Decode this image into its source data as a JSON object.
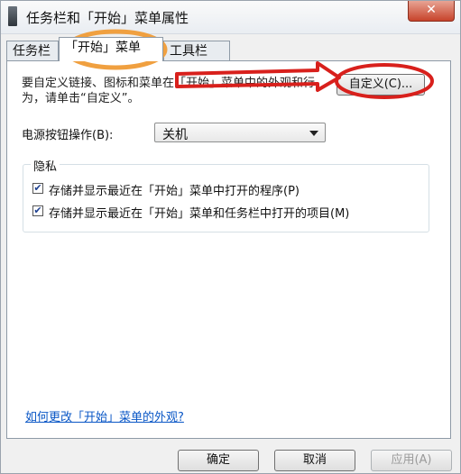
{
  "window": {
    "title": "任务栏和「开始」菜单属性",
    "close_glyph": "✕"
  },
  "tabs": [
    {
      "label": "任务栏"
    },
    {
      "label": "「开始」菜单"
    },
    {
      "label": "工具栏"
    }
  ],
  "start_menu": {
    "description": "要自定义链接、图标和菜单在「开始」菜单中的外观和行为，请单击“自定义”。",
    "customize_button": "自定义(C)...",
    "power_label": "电源按钮操作(B):",
    "power_value": "关机",
    "privacy_group_title": "隐私",
    "privacy_options": [
      {
        "label": "存储并显示最近在「开始」菜单中打开的程序(P)",
        "checked": true
      },
      {
        "label": "存储并显示最近在「开始」菜单和任务栏中打开的项目(M)",
        "checked": true
      }
    ],
    "help_link": "如何更改「开始」菜单的外观?"
  },
  "footer": {
    "ok": "确定",
    "cancel": "取消",
    "apply": "应用(A)"
  },
  "annotation_colors": {
    "circle_orange": "#f0a040",
    "circle_red": "#d8201c",
    "arrow_red": "#d8201c"
  }
}
